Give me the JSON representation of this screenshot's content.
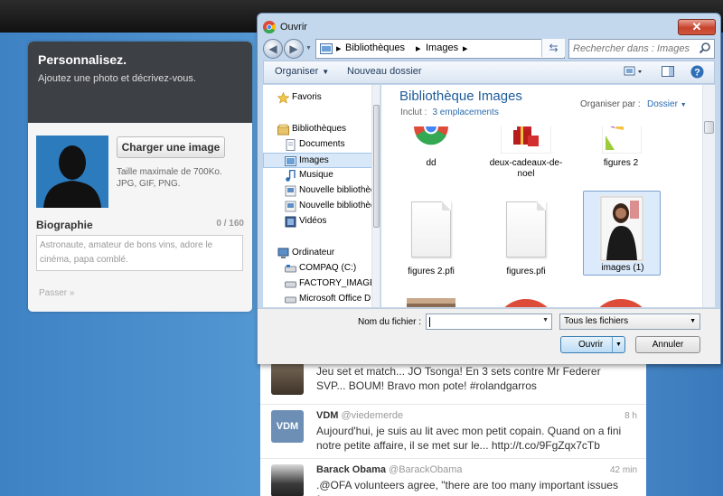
{
  "profile": {
    "title": "Personnalisez.",
    "subtitle": "Ajoutez une photo et décrivez-vous.",
    "upload_label": "Charger une image",
    "upload_hint_1": "Taille maximale de 700Ko.",
    "upload_hint_2": "JPG, GIF, PNG.",
    "bio_title": "Biographie",
    "bio_count": "0 / 160",
    "bio_placeholder": "Astronaute, amateur de bons vins, adore le cinéma, papa comblé.",
    "skip_label": "Passer »"
  },
  "feed": {
    "tweets": [
      {
        "name": "",
        "handle": "",
        "time": "",
        "text": "Jeu set et match... JO Tsonga! En 3 sets contre Mr Federer SVP... BOUM! Bravo mon pote! #rolandgarros"
      },
      {
        "name": "VDM",
        "handle": "@viedemerde",
        "time": "8 h",
        "text": "Aujourd'hui, je suis au lit avec mon petit copain. Quand on a fini notre petite affaire, il se met sur le... http://t.co/9FgZqx7cTb",
        "avatar_text": "VDM"
      },
      {
        "name": "Barack Obama",
        "handle": "@BarackObama",
        "time": "42 min",
        "text": ".@OFA volunteers agree, \"there are too many important issues for"
      }
    ]
  },
  "dialog": {
    "title": "Ouvrir",
    "close_glyph": "✕",
    "path": [
      "Bibliothèques",
      "Images"
    ],
    "search_placeholder": "Rechercher dans : Images",
    "toolbar": {
      "organize": "Organiser",
      "new_folder": "Nouveau dossier"
    },
    "nav": [
      {
        "label": "Favoris",
        "icon": "star-icon",
        "indent": 0
      },
      {
        "label": "Bibliothèques",
        "icon": "library-icon",
        "indent": 0
      },
      {
        "label": "Documents",
        "icon": "document-icon",
        "indent": 1
      },
      {
        "label": "Images",
        "icon": "image-icon",
        "indent": 1,
        "selected": true
      },
      {
        "label": "Musique",
        "icon": "music-icon",
        "indent": 1
      },
      {
        "label": "Nouvelle bibliothèque",
        "icon": "library-icon",
        "indent": 1
      },
      {
        "label": "Nouvelle bibliothèque",
        "icon": "library-icon",
        "indent": 1
      },
      {
        "label": "Vidéos",
        "icon": "video-icon",
        "indent": 1
      },
      {
        "label": "Ordinateur",
        "icon": "computer-icon",
        "indent": 0
      },
      {
        "label": "COMPAQ (C:)",
        "icon": "drive-icon",
        "indent": 1
      },
      {
        "label": "FACTORY_IMAGE (D:)",
        "icon": "drive-icon",
        "indent": 1
      },
      {
        "label": "Microsoft Office D",
        "icon": "drive-icon",
        "indent": 1
      }
    ],
    "library_title": "Bibliothèque Images",
    "includes_label": "Inclut :",
    "includes_link": "3 emplacements",
    "arrange_label": "Organiser par :",
    "arrange_value": "Dossier",
    "files": [
      {
        "name": "dd",
        "kind": "chrome"
      },
      {
        "name": "deux-cadeaux-de-noel",
        "kind": "gift"
      },
      {
        "name": "figures 2",
        "kind": "figure"
      },
      {
        "name": "figures 2.pfi",
        "kind": "doc"
      },
      {
        "name": "figures.pfi",
        "kind": "doc"
      },
      {
        "name": "images (1)",
        "kind": "photo",
        "selected": true
      },
      {
        "name": "",
        "kind": "photo2"
      },
      {
        "name": "",
        "kind": "chrome"
      },
      {
        "name": "",
        "kind": "chrome"
      }
    ],
    "filename_label": "Nom du fichier :",
    "filename_value": "",
    "filetype_value": "Tous les fichiers",
    "open_label": "Ouvrir",
    "cancel_label": "Annuler"
  }
}
